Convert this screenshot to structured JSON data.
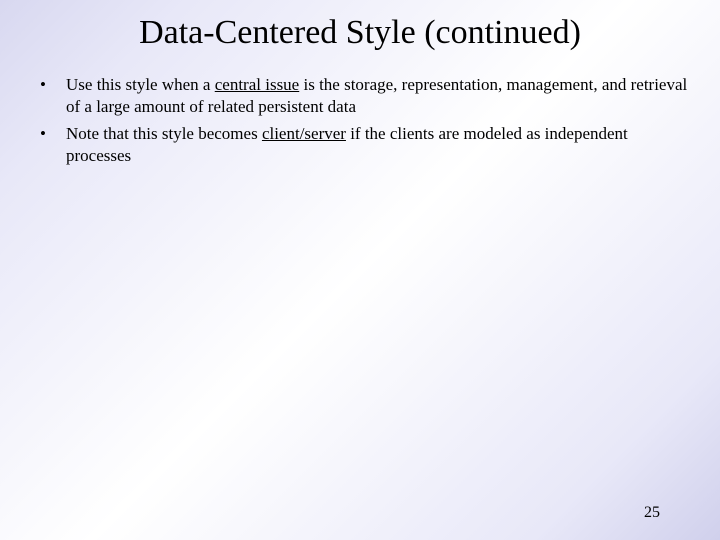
{
  "title": "Data-Centered Style (continued)",
  "bullets": [
    {
      "pre": "Use this style when a ",
      "u": "central issue",
      "post": " is the storage, representation, management, and retrieval of a large amount of related persistent data"
    },
    {
      "pre": "Note that this style becomes ",
      "u": "client/server",
      "post": " if the clients are modeled as independent processes"
    }
  ],
  "pageNumber": "25"
}
